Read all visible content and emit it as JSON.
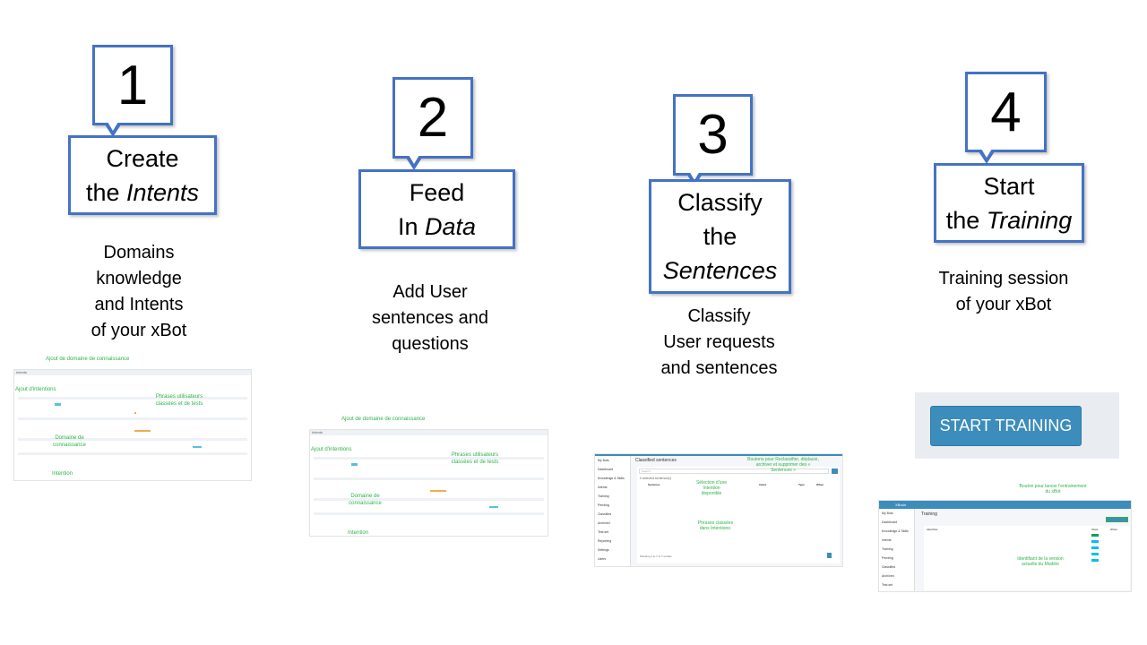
{
  "steps": [
    {
      "number": "1",
      "line1": "Create",
      "line2_prefix": "the ",
      "line2_italic": "Intents",
      "caption": [
        "Domains",
        "knowledge",
        "and Intents",
        "of your xBot"
      ]
    },
    {
      "number": "2",
      "line1": "Feed",
      "line2_prefix": "In ",
      "line2_italic": "Data",
      "caption": [
        "Add User",
        "sentences and",
        "questions"
      ]
    },
    {
      "number": "3",
      "line1": "Classify",
      "line1b": "the",
      "line2_prefix": "",
      "line2_italic": "Sentences",
      "caption": [
        "Classify",
        "User requests",
        "and sentences"
      ]
    },
    {
      "number": "4",
      "line1": "Start",
      "line2_prefix": "the ",
      "line2_italic": "Training",
      "caption": [
        "Training session",
        "of your xBot"
      ]
    }
  ],
  "thumb_intents": {
    "title": "Intents",
    "annotations": [
      "Ajout de domaine de connaissance",
      "Ajout d'intentions",
      "Phrases utilisateurs classées et de tests",
      "Domaine de connaissance",
      "Intention"
    ]
  },
  "thumb_classified": {
    "title": "Classified sentences",
    "search_placeholder": "Search...",
    "selected": "0 selected sentence(s)",
    "columns": [
      "Sentence",
      "Intent",
      "Type",
      "When"
    ],
    "footer": "Showing 1 to 7 of 7 entries",
    "sidebar": [
      "My Bots",
      "Dashboard",
      "Knowledge & Skills",
      "Intents",
      "Training",
      "Pending",
      "Classified",
      "Archived",
      "Test set",
      "Reporting",
      "Settings",
      "Users"
    ],
    "annotations": [
      "Boutons pour Reclassifier, déplacer, archiver et supprimer des « Sentences »",
      "Sélection d'une Intention disponible",
      "Phrases classées dans Intentions:"
    ]
  },
  "thumb_training": {
    "app": "XBrain",
    "title": "Training",
    "columns": [
      "Identifier",
      "State",
      "When"
    ],
    "sidebar": [
      "My Bots",
      "Dashboard",
      "Knowledge & Skills",
      "Intents",
      "Training",
      "Pending",
      "Classified",
      "Archived",
      "Test set"
    ],
    "annotations": [
      "Bouton pour lancer l'entrainement du xBot",
      "Identifiant de la version actuelle du Modèle"
    ]
  },
  "start_training": {
    "label": "START TRAINING",
    "color": "#3c8dbc"
  },
  "colors": {
    "callout_border": "#4472C4",
    "annotation": "#2fb34a"
  }
}
